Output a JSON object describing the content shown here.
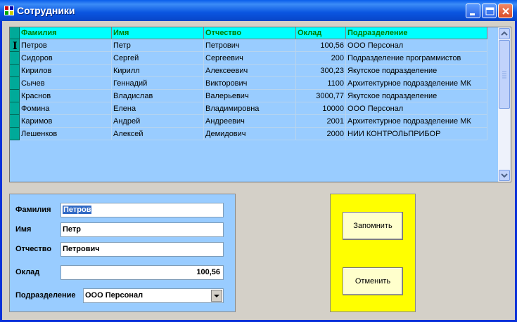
{
  "window": {
    "title": "Сотрудники"
  },
  "grid": {
    "columns": [
      "Фамилия",
      "Имя",
      "Отчество",
      "Оклад",
      "Подразделение"
    ],
    "rows": [
      [
        "Петров",
        "Петр",
        "Петрович",
        "100,56",
        "ООО Персонал"
      ],
      [
        "Сидоров",
        "Сергей",
        "Сергеевич",
        "200",
        "Подразделение программистов"
      ],
      [
        "Кирилов",
        "Кирилл",
        "Алексеевич",
        "300,23",
        "Якутское подразделение"
      ],
      [
        "Сычев",
        "Геннадий",
        "Викторович",
        "1100",
        "Архитектурное подразделение МК"
      ],
      [
        "Краснов",
        "Владислав",
        "Валерьевич",
        "3000,77",
        "Якутское подразделение"
      ],
      [
        "Фомина",
        "Елена",
        "Владимировна",
        "10000",
        "ООО Персонал"
      ],
      [
        "Каримов",
        "Андрей",
        "Андреевич",
        "2001",
        "Архитектурное подразделение МК"
      ],
      [
        "Лешенков",
        "Алексей",
        "Демидович",
        "2000",
        "НИИ КОНТРОЛЬПРИБОР"
      ]
    ]
  },
  "form": {
    "lastname_label": "Фамилия",
    "lastname_value": "Петров",
    "firstname_label": "Имя",
    "firstname_value": "Петр",
    "middlename_label": "Отчество",
    "middlename_value": "Петрович",
    "salary_label": "Оклад",
    "salary_value": "100,56",
    "department_label": "Подразделение",
    "department_value": "ООО Персонал"
  },
  "actions": {
    "save_label": "Запомнить",
    "cancel_label": "Отменить"
  },
  "colors": {
    "grid_bg": "#99ccff",
    "header_bg": "#00ffff",
    "header_text": "#008000",
    "button_panel": "#ffff00"
  }
}
